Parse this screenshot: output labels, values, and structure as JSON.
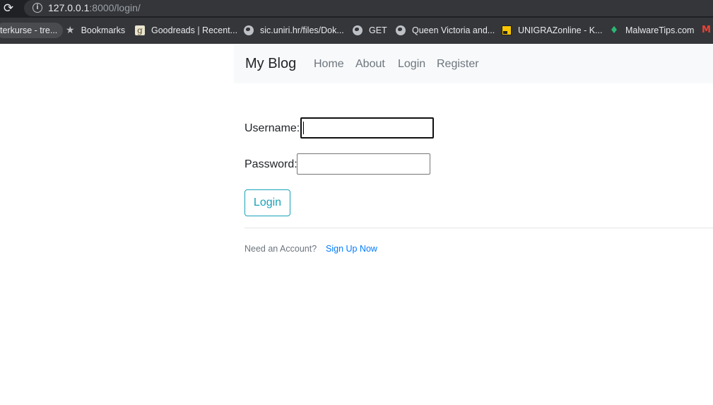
{
  "browser": {
    "reload_icon": "reload-icon",
    "info_icon": "info-icon",
    "url_host": "127.0.0.1",
    "url_rest": ":8000/login/"
  },
  "bookmarks": [
    {
      "label": "terkurse - tre...",
      "icon": "none"
    },
    {
      "label": "Bookmarks",
      "icon": "star-icon"
    },
    {
      "label": "Goodreads | Recent...",
      "icon": "goodreads-icon"
    },
    {
      "label": "sic.uniri.hr/files/Dok...",
      "icon": "globe-icon"
    },
    {
      "label": "GET",
      "icon": "globe-icon"
    },
    {
      "label": "Queen Victoria and...",
      "icon": "globe-icon"
    },
    {
      "label": "UNIGRAZonline - K...",
      "icon": "unigraz-icon"
    },
    {
      "label": "MalwareTips.com",
      "icon": "malwaretips-icon"
    },
    {
      "label": "",
      "icon": "gmail-icon"
    }
  ],
  "navbar": {
    "brand": "My Blog",
    "links": [
      "Home",
      "About",
      "Login",
      "Register"
    ]
  },
  "form": {
    "username_label": "Username:",
    "username_value": "",
    "password_label": "Password:",
    "password_value": "",
    "submit_label": "Login"
  },
  "footer": {
    "prompt": "Need an Account?",
    "signup_link": "Sign Up Now"
  },
  "colors": {
    "chrome_dark": "#202124",
    "bookmarks_bg": "#35363a",
    "navbar_bg": "#f8f9fa",
    "btn_outline": "#17a2b8",
    "link": "#007bff",
    "muted": "#6c757d"
  }
}
